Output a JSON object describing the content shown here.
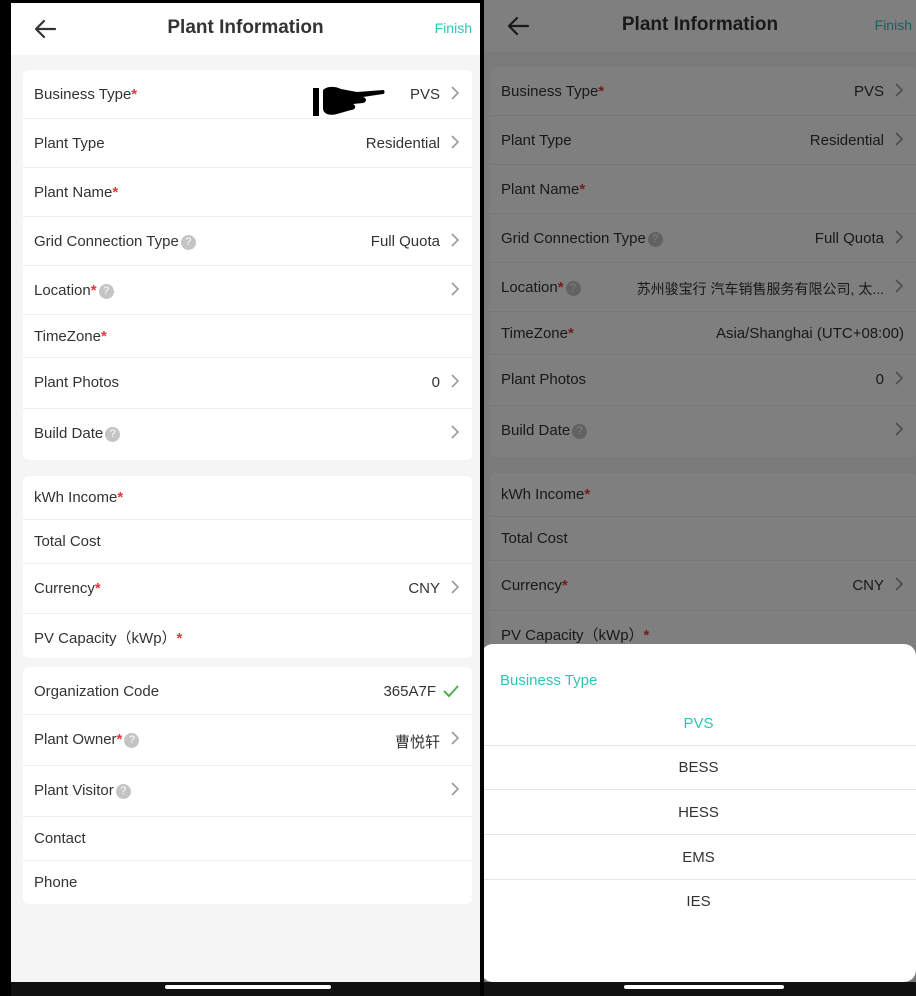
{
  "header": {
    "title": "Plant Information",
    "finish_label": "Finish",
    "back_icon": "arrow-left-icon"
  },
  "colors": {
    "accent": "#2ec4b6",
    "required_star": "#e5383b",
    "background": "#f5f5f5"
  },
  "required_mark": "*",
  "help_glyph": "?",
  "chevron_icon": "chevron-right-icon",
  "left": {
    "business_type": {
      "label": "Business Type",
      "value": "PVS"
    },
    "plant_type": {
      "label": "Plant Type",
      "value": "Residential"
    },
    "plant_name": {
      "label": "Plant Name"
    },
    "grid_connection_type": {
      "label": "Grid Connection Type",
      "value": "Full Quota"
    },
    "location": {
      "label": "Location",
      "value": ""
    },
    "timezone": {
      "label": "TimeZone",
      "value": ""
    },
    "plant_photos": {
      "label": "Plant Photos",
      "value": "0"
    },
    "build_date": {
      "label": "Build Date"
    },
    "kwh_income": {
      "label": "kWh Income"
    },
    "total_cost": {
      "label": "Total Cost"
    },
    "currency": {
      "label": "Currency",
      "value": "CNY"
    },
    "pv_capacity": {
      "label": "PV Capacity（kWp）"
    },
    "organization_code": {
      "label": "Organization Code",
      "value": "365A7F"
    },
    "plant_owner": {
      "label": "Plant Owner",
      "value": "曹悦轩"
    },
    "plant_visitor": {
      "label": "Plant Visitor"
    },
    "contact": {
      "label": "Contact"
    },
    "phone": {
      "label": "Phone"
    }
  },
  "right": {
    "business_type": {
      "label": "Business Type",
      "value": "PVS"
    },
    "plant_type": {
      "label": "Plant Type",
      "value": "Residential"
    },
    "plant_name": {
      "label": "Plant Name"
    },
    "grid_connection_type": {
      "label": "Grid Connection Type",
      "value": "Full Quota"
    },
    "location": {
      "label": "Location",
      "value": "苏州骏宝行 汽车销售服务有限公司, 太..."
    },
    "timezone": {
      "label": "TimeZone",
      "value": "Asia/Shanghai (UTC+08:00)"
    },
    "plant_photos": {
      "label": "Plant Photos",
      "value": "0"
    },
    "build_date": {
      "label": "Build Date"
    },
    "kwh_income": {
      "label": "kWh Income"
    },
    "total_cost": {
      "label": "Total Cost"
    },
    "currency": {
      "label": "Currency",
      "value": "CNY"
    },
    "pv_capacity": {
      "label": "PV Capacity（kWp）"
    }
  },
  "picker": {
    "title": "Business Type",
    "options": [
      "PVS",
      "BESS",
      "HESS",
      "EMS",
      "IES"
    ],
    "selected": "PVS"
  }
}
